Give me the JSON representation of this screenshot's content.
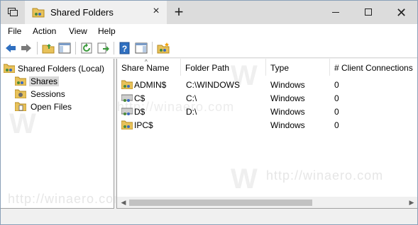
{
  "titlebar": {
    "tab_title": "Shared Folders",
    "close_glyph": "×",
    "new_tab_glyph": "+",
    "close_window_glyph": "✕"
  },
  "menu": {
    "items": [
      "File",
      "Action",
      "View",
      "Help"
    ]
  },
  "toolbar": {
    "icons": [
      "back-arrow-icon",
      "forward-arrow-icon",
      "up-folder-icon",
      "show-hide-tree-icon",
      "refresh-icon",
      "export-list-icon",
      "help-icon",
      "properties-pane-icon",
      "new-share-icon"
    ]
  },
  "tree": {
    "root": "Shared Folders (Local)",
    "items": [
      "Shares",
      "Sessions",
      "Open Files"
    ],
    "selected": "Shares"
  },
  "list": {
    "columns": [
      "Share Name",
      "Folder Path",
      "Type",
      "# Client Connections"
    ],
    "rows": [
      {
        "name": "ADMIN$",
        "path": "C:\\WINDOWS",
        "type": "Windows",
        "connections": "0"
      },
      {
        "name": "C$",
        "path": "C:\\",
        "type": "Windows",
        "connections": "0"
      },
      {
        "name": "D$",
        "path": "D:\\",
        "type": "Windows",
        "connections": "0"
      },
      {
        "name": "IPC$",
        "path": "",
        "type": "Windows",
        "connections": "0"
      }
    ]
  },
  "watermark": "http://winaero.com",
  "colors": {
    "folder_yellow": "#e8c25a",
    "folder_dark": "#b58a1f",
    "tool_blue": "#2f6fc0",
    "tool_green": "#3a9a3a",
    "selection": "#d9d9d9"
  }
}
